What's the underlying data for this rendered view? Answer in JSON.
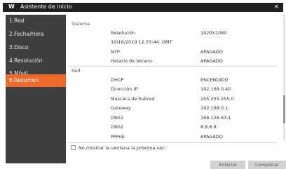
{
  "window": {
    "logo": "W",
    "title": "Asistente de inicio",
    "close": "×"
  },
  "sidebar": {
    "items": [
      {
        "label": "1.Red"
      },
      {
        "label": "2.Fecha/Hora"
      },
      {
        "label": "3.Disco"
      },
      {
        "label": "4.Resolución"
      },
      {
        "label": "5.Móvil"
      },
      {
        "label": "6.Resumen"
      }
    ]
  },
  "summary": {
    "system_title": "Sistema",
    "system_rows": [
      {
        "key": "Resolución",
        "value": "1920X1080"
      },
      {
        "key": "10/16/2019 12:55:44, GMT",
        "value": ""
      },
      {
        "key": "NTP",
        "value": "APAGADO"
      },
      {
        "key": "Horario de Verano",
        "value": "APAGADO"
      }
    ],
    "network_title": "Red",
    "network_rows": [
      {
        "key": "DHCP",
        "value": "ENCENDIDO"
      },
      {
        "key": "Dirección IP",
        "value": "192.168.0.40"
      },
      {
        "key": "Máscara de Subred",
        "value": "255.255.255.0"
      },
      {
        "key": "Gateway",
        "value": "192.168.0.1"
      },
      {
        "key": "DNS1",
        "value": "168.126.63.1"
      },
      {
        "key": "DNS2",
        "value": "8.8.8.8"
      },
      {
        "key": "PPPoE",
        "value": "APAGADO"
      }
    ]
  },
  "footer": {
    "checkbox_label": "No mostrar la ventana la próxima vez.",
    "back_label": "Anterior",
    "finish_label": "Completar"
  },
  "colors": {
    "accent": "#ef6a2d",
    "sidebar_bg": "#3f3f3f",
    "titlebar_bg": "#202020"
  }
}
